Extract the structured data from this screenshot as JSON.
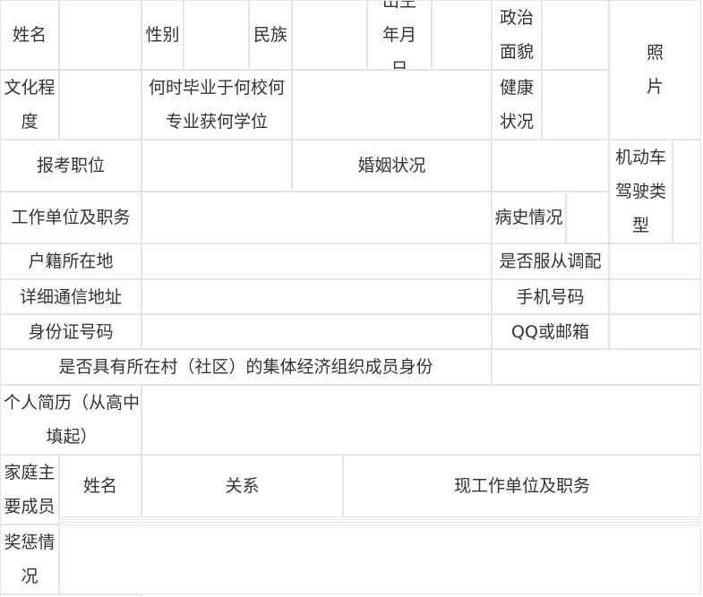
{
  "form": {
    "name_label": "姓名",
    "gender_label": "性别",
    "ethnicity_label": "民族",
    "birth_label": "出生年月日",
    "politics_label": "政治面貌",
    "photo_label": "照片",
    "education_label": "文化程度",
    "graduation_label": "何时毕业于何校何专业获何学位",
    "health_label": "健康状况",
    "position_label": "报考职位",
    "marital_label": "婚姻状况",
    "license_label": "机动车驾驶类型",
    "work_label": "工作单位及职务",
    "medical_label": "病史情况",
    "household_label": "户籍所在地",
    "obey_label": "是否服从调配",
    "address_label": "详细通信地址",
    "phone_label": "手机号码",
    "id_label": "身份证号码",
    "qq_label": "QQ或邮箱",
    "collective_label": "是否具有所在村（社区）的集体经济组织成员身份",
    "resume_label": "个人简历（从高中填起）",
    "family_label": "家庭主要成员",
    "family_name_header": "姓名",
    "family_relation_header": "关系",
    "family_work_header": "现工作单位及职务",
    "awards_label": "奖惩情况"
  }
}
